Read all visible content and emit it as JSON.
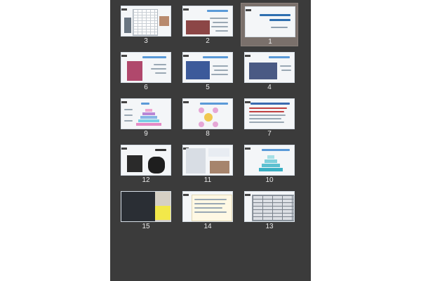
{
  "slides": [
    {
      "number": "3",
      "selected": false
    },
    {
      "number": "2",
      "selected": false
    },
    {
      "number": "1",
      "selected": true,
      "title": "استعدادیابی و پدیده ورزش در والیبال"
    },
    {
      "number": "6",
      "selected": false
    },
    {
      "number": "5",
      "selected": false
    },
    {
      "number": "4",
      "selected": false
    },
    {
      "number": "9",
      "selected": false
    },
    {
      "number": "8",
      "selected": false
    },
    {
      "number": "7",
      "selected": false
    },
    {
      "number": "12",
      "selected": false
    },
    {
      "number": "11",
      "selected": false
    },
    {
      "number": "10",
      "selected": false
    },
    {
      "number": "15",
      "selected": false
    },
    {
      "number": "14",
      "selected": false
    },
    {
      "number": "13",
      "selected": false
    }
  ]
}
